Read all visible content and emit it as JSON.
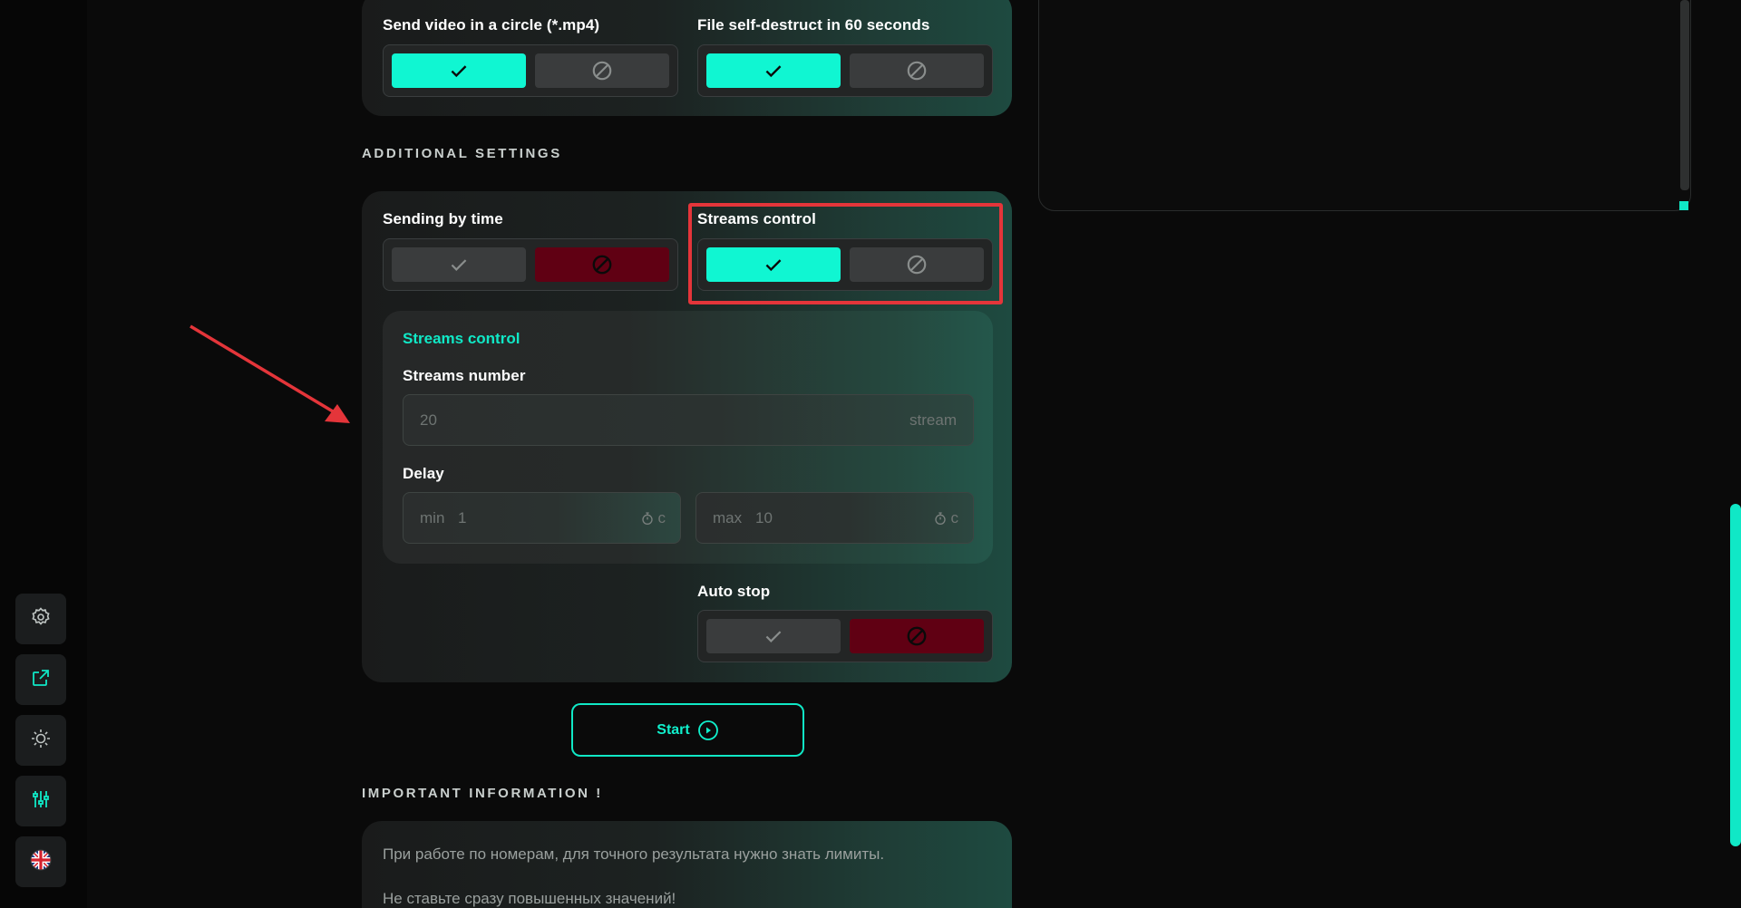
{
  "top_card": {
    "send_video_label": "Send video in a circle (*.mp4)",
    "self_destruct_label": "File self-destruct in 60 seconds"
  },
  "sections": {
    "additional_settings": "ADDITIONAL SETTINGS",
    "important_information": "IMPORTANT INFORMATION !"
  },
  "additional": {
    "sending_by_time_label": "Sending by time",
    "streams_control_label": "Streams control",
    "auto_stop_label": "Auto stop"
  },
  "streams_panel": {
    "title": "Streams control",
    "streams_number_label": "Streams number",
    "streams_number_value": "20",
    "streams_number_suffix": "stream",
    "delay_label": "Delay",
    "delay_min_prefix": "min",
    "delay_min_value": "1",
    "delay_max_prefix": "max",
    "delay_max_value": "10",
    "delay_unit": "c"
  },
  "start_button": {
    "label": "Start"
  },
  "info": {
    "line1": "При работе по номерам, для точного результата нужно знать лимиты.",
    "line2": "Не ставьте сразу повышенных значений!"
  },
  "icons": {
    "rail": [
      "settings-gear-icon",
      "external-link-icon",
      "sun-theme-icon",
      "sliders-icon",
      "uk-flag-icon"
    ],
    "toggle_on": "check-icon",
    "toggle_off": "ban-icon"
  },
  "colors": {
    "accent": "#10f6d2",
    "danger": "#600013",
    "annotation": "#e4353a"
  }
}
